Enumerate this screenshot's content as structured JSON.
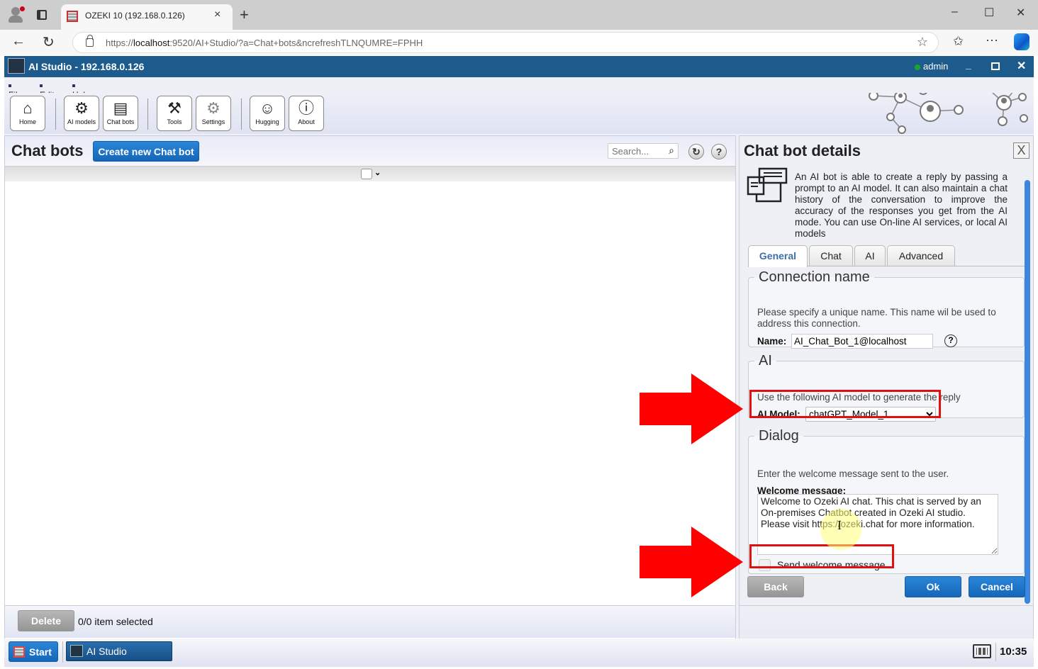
{
  "browser": {
    "tab_title": "OZEKI 10 (192.168.0.126)",
    "url_prefix": "https://",
    "url_host": "localhost",
    "url_rest": ":9520/AI+Studio/?a=Chat+bots&ncrefreshTLNQUMRE=FPHH",
    "new_tab_label": "+",
    "tab_close_label": "×",
    "window_controls": {
      "minimize": "–",
      "maximize": "☐",
      "close": "✕"
    },
    "icons": {
      "back": "←",
      "reload": "↻",
      "star": "☆",
      "favorites": "✩",
      "more": "···"
    }
  },
  "app": {
    "title": "AI Studio - 192.168.0.126",
    "user": "admin",
    "user_status_color": "#1aa52a",
    "title_controls": {
      "minimize": "_",
      "close": "✕"
    },
    "menu": [
      "File",
      "Edit",
      "Help"
    ],
    "toolbar": [
      {
        "label": "Home",
        "icon": "⌂"
      },
      {
        "label": "AI models",
        "icon": "⚙"
      },
      {
        "label": "Chat bots",
        "icon": "▤"
      },
      {
        "label": "Tools",
        "icon": "⚒"
      },
      {
        "label": "Settings",
        "icon": "⚙"
      },
      {
        "label": "Hugging",
        "icon": "☺"
      },
      {
        "label": "About",
        "icon": "ⓘ"
      }
    ]
  },
  "list_pane": {
    "title": "Chat bots",
    "create_button": "Create new Chat bot",
    "search_placeholder": "Search...",
    "search_icon": "⌕",
    "refresh_icon": "↻",
    "help_icon": "?",
    "select_chevron": "⌄",
    "delete_button": "Delete",
    "selection_status": "0/0 item selected"
  },
  "details": {
    "title": "Chat bot details",
    "close_label": "X",
    "intro": "An AI bot is able to create a reply by passing a prompt to an AI model. It can also maintain a chat history of the conversation to improve the accuracy of the responses you get from the AI mode. You can use On-line AI services, or local AI models",
    "tabs": [
      {
        "label": "General",
        "active": true
      },
      {
        "label": "Chat",
        "active": false
      },
      {
        "label": "AI",
        "active": false
      },
      {
        "label": "Advanced",
        "active": false
      }
    ],
    "connection": {
      "legend": "Connection name",
      "description": "Please specify a unique name. This name wil be used to address this connection.",
      "name_label": "Name:",
      "name_value": "AI_Chat_Bot_1@localhost",
      "help_icon": "?"
    },
    "ai": {
      "legend": "AI",
      "description": "Use the following AI model to generate the reply",
      "model_label": "AI Model:",
      "model_value": "chatGPT_Model_1"
    },
    "dialog": {
      "legend": "Dialog",
      "description": "Enter the welcome message sent to the user.",
      "welcome_label": "Welcome message:",
      "welcome_value": "Welcome to Ozeki AI chat. This chat is served by an On-premises Chatbot created in Ozeki AI studio. Please visit https://ozeki.chat for more information.",
      "send_welcome_label": "Send welcome message.",
      "send_welcome_checked": false
    },
    "buttons": {
      "back": "Back",
      "ok": "Ok",
      "cancel": "Cancel"
    },
    "cursor_icon": "I"
  },
  "annotations": {
    "arrow_color": "#ff0000",
    "highlight_color": "#e01010"
  },
  "taskbar": {
    "start_label": "Start",
    "app_label": "AI Studio",
    "clock": "10:35"
  }
}
